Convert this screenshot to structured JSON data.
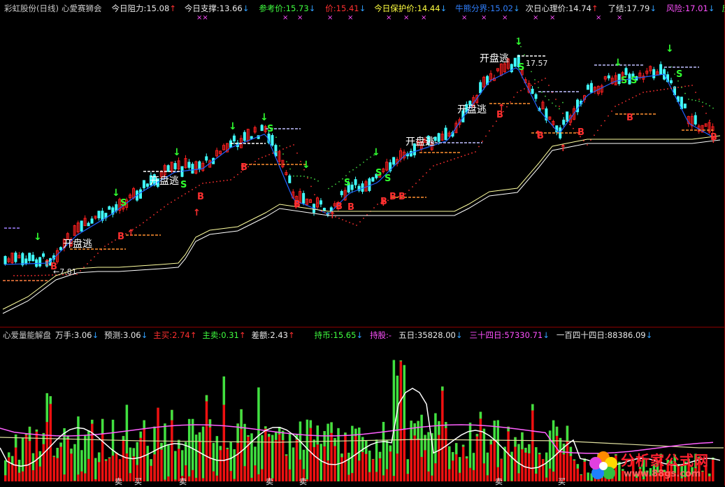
{
  "top_bar": {
    "stock_title": "彩虹股份(日线)",
    "indicator_name": "心愛赛狮会",
    "resist_label": "今日阻力:15.08",
    "support_label": "今日支撑:13.66",
    "ref_price": "参考价:15.73",
    "price": "价:15.41",
    "protect_price": "今日保护价:14.44",
    "bull_bear_line": "牛熊分界:15.02",
    "next_psych_price": "次日心理价:14.74",
    "finish": "了结:17.79",
    "risk": "风险:17.01",
    "rebound": "反弹"
  },
  "chart_labels": {
    "escape_1": "开盘逃",
    "escape_2": "开盘逃",
    "escape_3": "开盘逃",
    "escape_4": "开盘逃",
    "escape_5": "开盘逃",
    "high_price": "17.57",
    "low_price": "←7.81",
    "buy": "B",
    "sell": "S"
  },
  "vol_bar": {
    "indicator_name": "心爱量能解盘",
    "wan_shou": "万手:3.06",
    "forecast": "预测:3.06",
    "main_buy": "主买:2.74",
    "main_sell": "主卖:0.31",
    "diff": "差额:2.43",
    "hold_coin": "持币:15.65",
    "hold_stock": "持股:-",
    "day5": "五日:35828.00",
    "day34": "三十四日:57330.71",
    "day144": "一百四十四日:88386.09"
  },
  "bottom_labels": {
    "sell": "卖",
    "buy": "买"
  },
  "watermark": {
    "title": "分析家公式网",
    "url": "www.88gs.com"
  },
  "colors": {
    "up": "#ff2020",
    "down": "#40ffff",
    "ma": "#ffff80",
    "blue_line": "#2060ff",
    "red_dots": "#ff3030",
    "green_dots": "#40d040",
    "white_line": "#ffffff",
    "pink_line": "#ff60ff",
    "vol_red": "#ee1010",
    "vol_green": "#40e040",
    "vol_dark_green": "#208020"
  }
}
